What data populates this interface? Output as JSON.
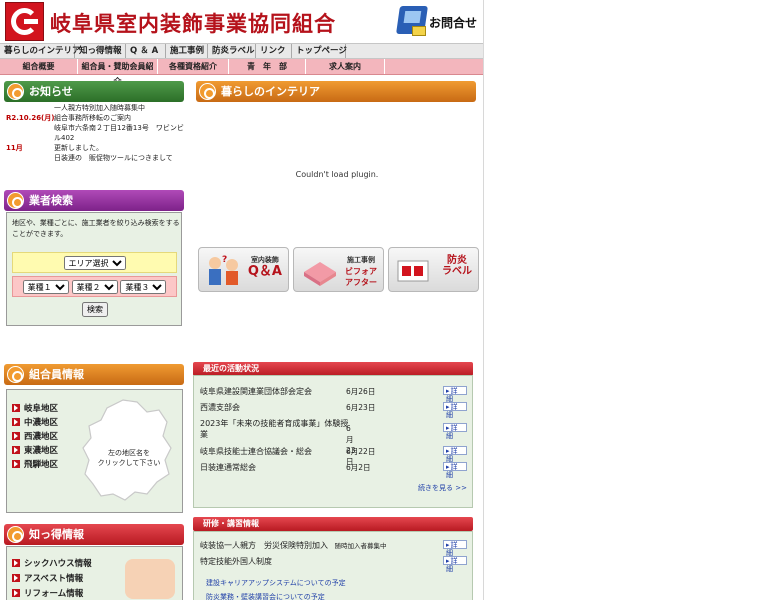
{
  "header": {
    "title": "岐阜県室内装飾事業協同組合",
    "contact_label": "お問合せ"
  },
  "nav_primary": [
    "暮らしのインテリア",
    "知っ得情報",
    "Q ＆ A",
    "施工事例",
    "防炎ラベル",
    "リンク",
    "トップページ"
  ],
  "nav_secondary": [
    "組合概要",
    "組合員・賛助会員紹介",
    "各種資格紹介",
    "青　年　部",
    "求人案内"
  ],
  "news": {
    "heading": "お知らせ",
    "items": [
      {
        "date": "",
        "text": "一人親方特別加入随時募集中"
      },
      {
        "date": "R2.10.26(月)",
        "text": "組合事務所移転のご案内"
      },
      {
        "date": "",
        "text": "岐阜市六条南２丁目12番13号　ワビンビル402"
      },
      {
        "date": "11月",
        "text": "更新しました。"
      },
      {
        "date": "",
        "text": "日装連の　販促物ツールにつきまして"
      }
    ]
  },
  "search": {
    "heading": "業者検索",
    "description": "地区や、業種ごとに、施工業者を絞り込み検索をすることができます。",
    "area_select": "エリア選択",
    "kind_selects": [
      "業種１",
      "業種２",
      "業種３"
    ],
    "button": "検索"
  },
  "interior": {
    "heading": "暮らしのインテリア",
    "plugin_message": "Couldn't load plugin."
  },
  "banners": [
    {
      "small": "室内装飾",
      "big": "Q＆A"
    },
    {
      "small": "施工事例",
      "big": "ビフォア\nアフター"
    },
    {
      "small": "",
      "big": "防炎\nラベル"
    }
  ],
  "member": {
    "heading": "組合員情報",
    "areas": [
      "岐阜地区",
      "中濃地区",
      "西濃地区",
      "東濃地区",
      "飛騨地区"
    ],
    "map_label": "左の地区名を\nクリックして下さい"
  },
  "activity": {
    "heading": "最近の活動状況",
    "items": [
      {
        "title": "岐阜県建設関連業団体部会定会",
        "date": "6月26日"
      },
      {
        "title": "西濃支部会",
        "date": "6月23日"
      },
      {
        "title": "2023年「未来の技能者育成事業」体験授業",
        "date": "6月23日"
      },
      {
        "title": "岐阜県技能士連合協議会・総会",
        "date": "6月22日"
      },
      {
        "title": "日装連通常総会",
        "date": "6月2日"
      }
    ],
    "detail_label": "詳細",
    "more": "続きを見る >>"
  },
  "knowledge": {
    "heading": "知っ得情報",
    "items": [
      "シックハウス情報",
      "アスベスト情報",
      "リフォーム情報"
    ]
  },
  "training": {
    "heading": "研修・講習情報",
    "items": [
      {
        "title": "岐装協一人親方　労災保険特別加入",
        "note": "随時加入者募集中"
      },
      {
        "title": "特定技能外国人制度",
        "note": ""
      }
    ],
    "links": [
      "建設キャリアアップシステムについての予定",
      "防炎業務・壁装講習会についての予定"
    ],
    "detail_label": "詳細"
  },
  "colors": {
    "brand_red": "#b5121b",
    "green_header": "#2c6f28",
    "orange_header": "#c86a14",
    "purple_header": "#7d2289",
    "red_header": "#b81a22"
  }
}
